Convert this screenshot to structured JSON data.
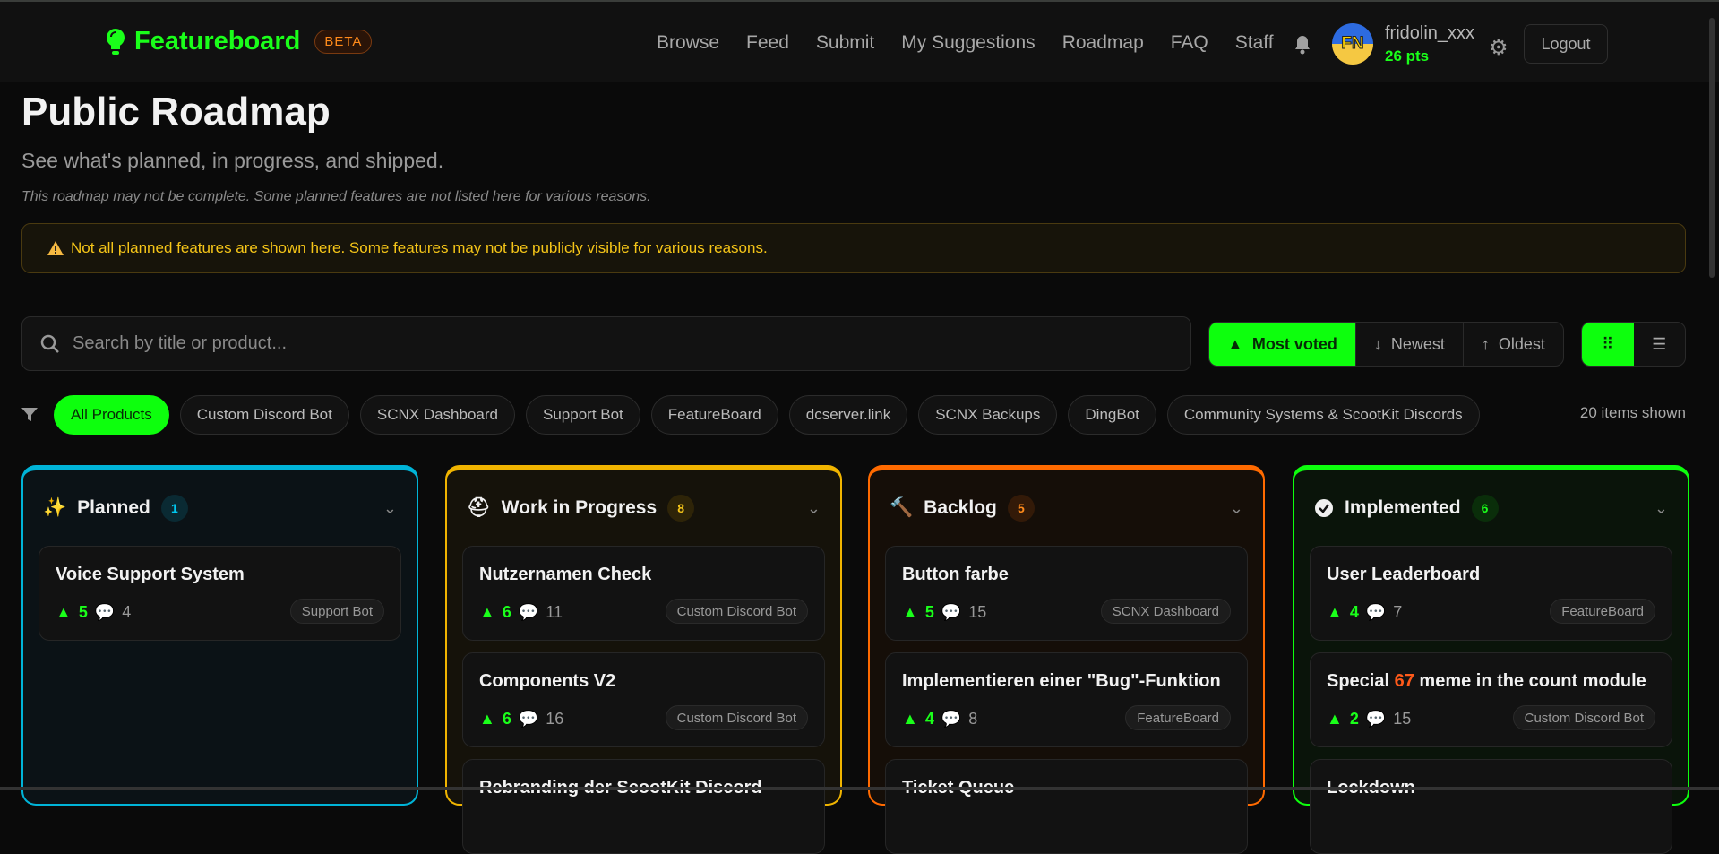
{
  "header": {
    "brand": "Featureboard",
    "badge": "BETA",
    "nav": [
      "Browse",
      "Feed",
      "Submit",
      "My Suggestions",
      "Roadmap",
      "FAQ",
      "Staff"
    ],
    "user": {
      "name": "fridolin_xxx",
      "points": "26 pts",
      "avatar_initials": "FN"
    },
    "logout": "Logout"
  },
  "page": {
    "title": "Public Roadmap",
    "subtitle": "See what's planned, in progress, and shipped.",
    "note": "This roadmap may not be complete. Some planned features are not listed here for various reasons.",
    "warning": "Not all planned features are shown here. Some features may not be publicly visible for various reasons."
  },
  "search": {
    "placeholder": "Search by title or product..."
  },
  "sort": {
    "options": [
      "Most voted",
      "Newest",
      "Oldest"
    ],
    "active": "Most voted"
  },
  "view": {
    "active": "grid"
  },
  "filters": {
    "chips": [
      "All Products",
      "Custom Discord Bot",
      "SCNX Dashboard",
      "Support Bot",
      "FeatureBoard",
      "dcserver.link",
      "SCNX Backups",
      "DingBot",
      "Community Systems & ScootKit Discords"
    ],
    "active": "All Products",
    "shown": "20 items shown"
  },
  "colors": {
    "accent": "#0dff0d",
    "planned": "#00b4d8",
    "wip": "#f0b400",
    "backlog": "#ff6a00",
    "implemented": "#0dff0d"
  },
  "columns": [
    {
      "title": "Planned",
      "count": "1",
      "icon": "magic-wand-icon",
      "cards": [
        {
          "title": "Voice Support System",
          "votes": "5",
          "comments": "4",
          "tag": "Support Bot"
        }
      ]
    },
    {
      "title": "Work in Progress",
      "count": "8",
      "icon": "hard-hat-icon",
      "cards": [
        {
          "title": "Nutzernamen Check",
          "votes": "6",
          "comments": "11",
          "tag": "Custom Discord Bot"
        },
        {
          "title": "Components V2",
          "votes": "6",
          "comments": "16",
          "tag": "Custom Discord Bot"
        },
        {
          "title": "Rebranding der ScootKit Discord-"
        }
      ]
    },
    {
      "title": "Backlog",
      "count": "5",
      "icon": "hammer-icon",
      "cards": [
        {
          "title": "Button farbe",
          "votes": "5",
          "comments": "15",
          "tag": "SCNX Dashboard"
        },
        {
          "title": "Implementieren einer \"Bug\"-Funktion",
          "votes": "4",
          "comments": "8",
          "tag": "FeatureBoard"
        },
        {
          "title": "Ticket Queue"
        }
      ]
    },
    {
      "title": "Implemented",
      "count": "6",
      "icon": "check-circle-icon",
      "cards": [
        {
          "title": "User Leaderboard",
          "votes": "4",
          "comments": "7",
          "tag": "FeatureBoard"
        },
        {
          "title_pre": "Special ",
          "title_hl": "67",
          "title_post": " meme in the count module",
          "votes": "2",
          "comments": "15",
          "tag": "Custom Discord Bot"
        },
        {
          "title": "Lockdown"
        }
      ]
    }
  ]
}
